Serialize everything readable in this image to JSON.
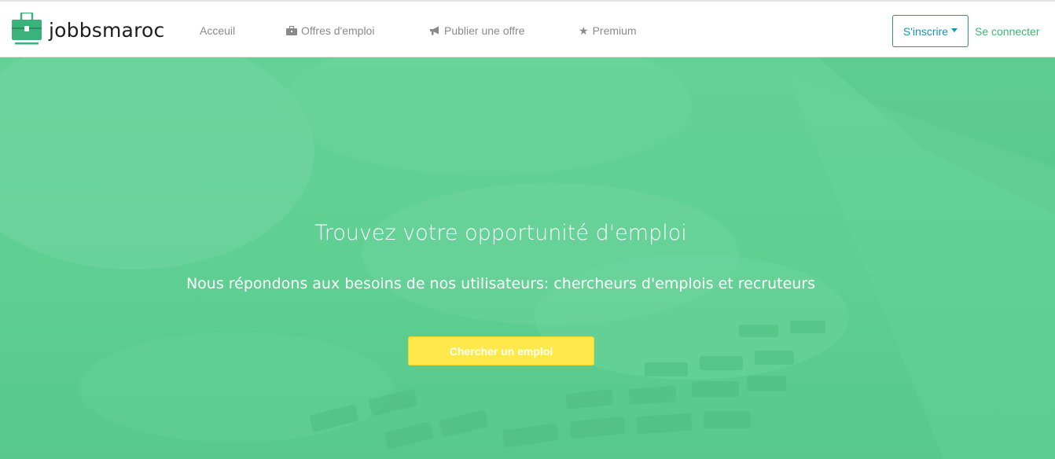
{
  "brand": {
    "name": "jobbsmaroc",
    "logo_icon": "briefcase-icon",
    "logo_color": "#3bb27a"
  },
  "nav": {
    "items": [
      {
        "label": "Acceuil",
        "icon": null
      },
      {
        "label": "Offres d'emploi",
        "icon": "briefcase-icon"
      },
      {
        "label": "Publier une offre",
        "icon": "bullhorn-icon"
      },
      {
        "label": "Premium",
        "icon": "star-icon"
      }
    ],
    "signup_label": "S'inscrire",
    "login_label": "Se connecter"
  },
  "hero": {
    "title": "Trouvez votre opportunité d'emploi",
    "subtitle": "Nous répondons aux besoins de nos utilisateurs: chercheurs d'emplois et recruteurs",
    "cta_label": "Chercher un emploi",
    "overlay_color": "#5fcf92",
    "cta_color": "#ffe94a"
  },
  "colors": {
    "accent_blue": "#1f8fb5",
    "accent_green": "#3db870"
  }
}
